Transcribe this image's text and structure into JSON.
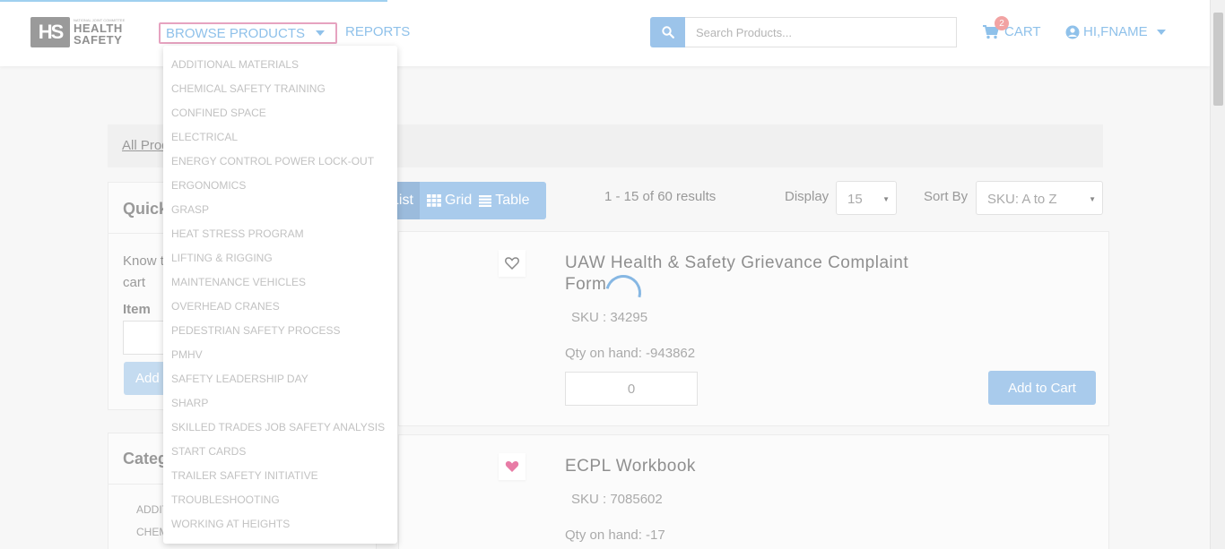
{
  "header": {
    "logo": {
      "small_text": "NATIONAL JOINT COMMITTEE",
      "line1": "HEALTH",
      "line2": "SAFETY",
      "mark": "HS"
    },
    "browse_label": "BROWSE PRODUCTS",
    "reports_label": "REPORTS",
    "search_placeholder": "Search Products...",
    "cart_count": "2",
    "cart_label": "CART",
    "user_label": "HI,FNAME"
  },
  "dropdown": {
    "items": [
      "ADDITIONAL MATERIALS",
      "CHEMICAL SAFETY TRAINING",
      "CONFINED SPACE",
      "ELECTRICAL",
      "ENERGY CONTROL POWER LOCK-OUT",
      "ERGONOMICS",
      "GRASP",
      "HEAT STRESS PROGRAM",
      "LIFTING & RIGGING",
      "MAINTENANCE VEHICLES",
      "OVERHEAD CRANES",
      "PEDESTRIAN SAFETY PROCESS",
      "PMHV",
      "SAFETY LEADERSHIP DAY",
      "SHARP",
      "SKILLED TRADES JOB SAFETY ANALYSIS",
      "START CARDS",
      "TRAILER SAFETY INITIATIVE",
      "TROUBLESHOOTING",
      "WORKING AT HEIGHTS"
    ]
  },
  "breadcrumb": {
    "all_products": "All Products"
  },
  "quick_order": {
    "title": "Quick Order",
    "text": "Know the item number? Add it to the cart",
    "item_label": "Item",
    "add_label": "Add"
  },
  "categories": {
    "title": "Categories",
    "items": [
      "ADDITIONAL MATERIALS",
      "CHEMICAL SAFETY TRAINING"
    ]
  },
  "toolbar": {
    "list_label": "List",
    "grid_label": "Grid",
    "table_label": "Table",
    "results": "1 - 15 of 60 results",
    "display_label": "Display",
    "display_value": "15",
    "sort_label": "Sort By",
    "sort_value": "SKU: A to Z"
  },
  "products": [
    {
      "title": "UAW Health & Safety Grievance Complaint Form",
      "sku": "SKU : 34295",
      "qty": "Qty on hand: -943862",
      "qty_value": "0",
      "add_label": "Add to Cart",
      "favorite": false
    },
    {
      "title": "ECPL Workbook",
      "sku": "SKU : 7085602",
      "qty": "Qty on hand: -17",
      "favorite": true
    }
  ],
  "colors": {
    "accent": "#8fc1ea",
    "favorite": "#e87ca6",
    "button": "#a9cbec"
  }
}
